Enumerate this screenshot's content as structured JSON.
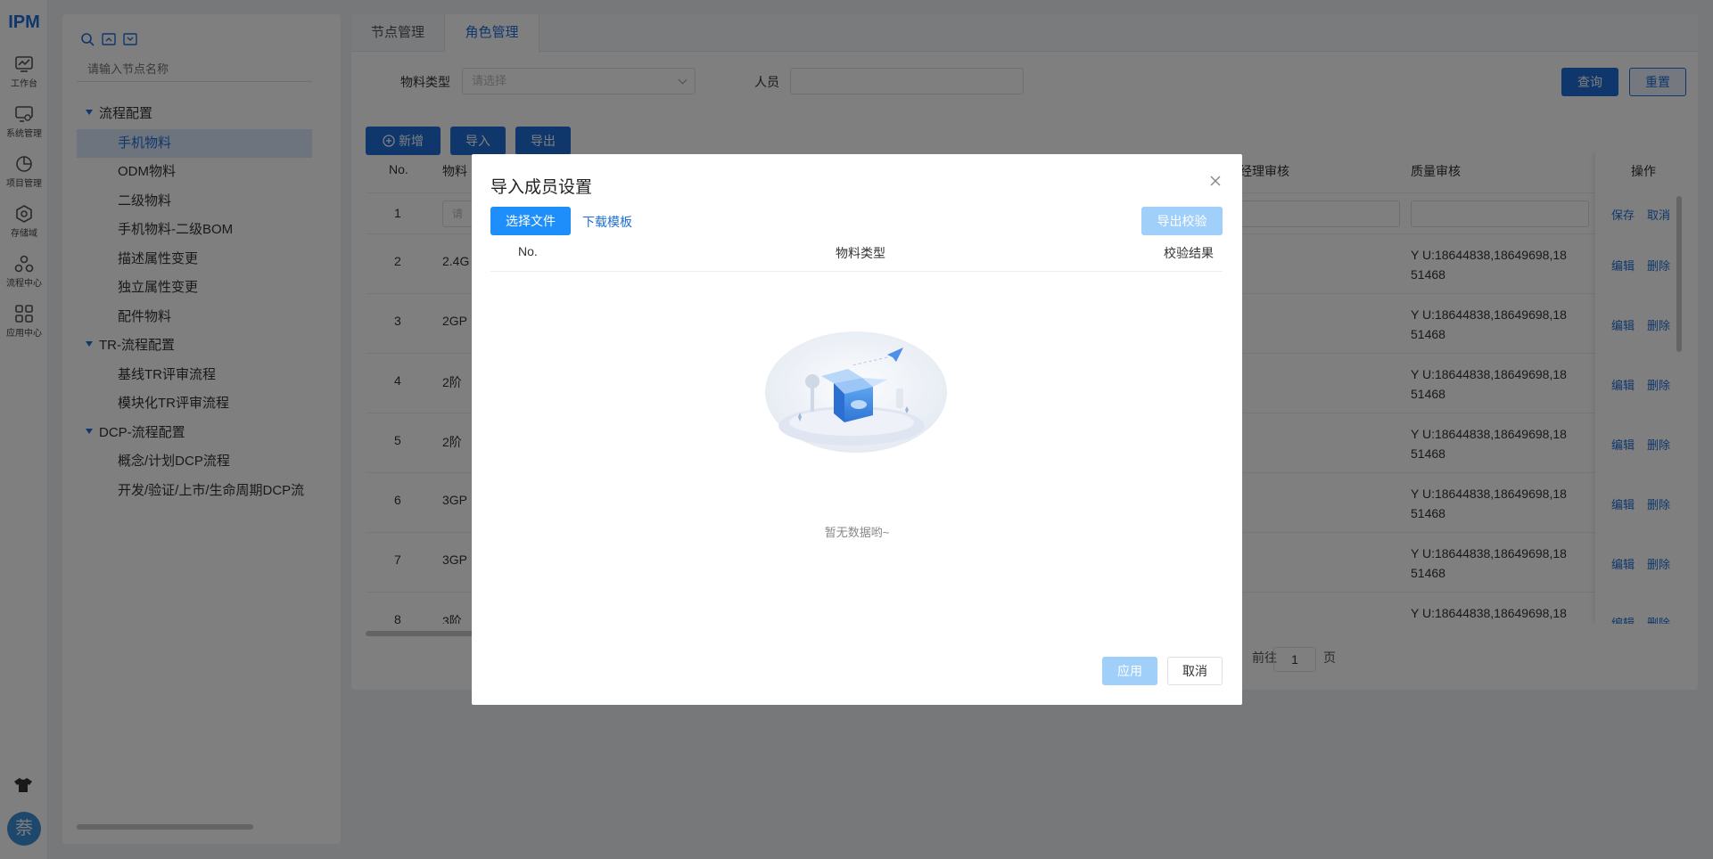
{
  "app": {
    "logo": "IPM",
    "avatar": "萘"
  },
  "rail": [
    {
      "label": "工作台",
      "icon": "chart-board-icon"
    },
    {
      "label": "系统管理",
      "icon": "monitor-settings-icon"
    },
    {
      "label": "项目管理",
      "icon": "pie-chart-icon"
    },
    {
      "label": "存储域",
      "icon": "storage-hexagon-icon"
    },
    {
      "label": "流程中心",
      "icon": "flow-nodes-icon"
    },
    {
      "label": "应用中心",
      "icon": "app-grid-icon"
    }
  ],
  "tree": {
    "search_placeholder": "请输入节点名称",
    "items": [
      {
        "label": "流程配置",
        "type": "group"
      },
      {
        "label": "手机物料",
        "type": "leaf",
        "active": true
      },
      {
        "label": "ODM物料",
        "type": "leaf"
      },
      {
        "label": "二级物料",
        "type": "leaf"
      },
      {
        "label": "手机物料-二级BOM",
        "type": "leaf"
      },
      {
        "label": "描述属性变更",
        "type": "leaf"
      },
      {
        "label": "独立属性变更",
        "type": "leaf"
      },
      {
        "label": "配件物料",
        "type": "leaf"
      },
      {
        "label": "TR-流程配置",
        "type": "group"
      },
      {
        "label": "基线TR评审流程",
        "type": "leaf"
      },
      {
        "label": "模块化TR评审流程",
        "type": "leaf"
      },
      {
        "label": "DCP-流程配置",
        "type": "group"
      },
      {
        "label": "概念/计划DCP流程",
        "type": "leaf"
      },
      {
        "label": "开发/验证/上市/生命周期DCP流",
        "type": "leaf"
      }
    ]
  },
  "main": {
    "tabs": [
      "节点管理",
      "角色管理"
    ],
    "filters": {
      "material_type_label": "物料类型",
      "material_type_placeholder": "请选择",
      "person_label": "人员"
    },
    "buttons": {
      "query": "查询",
      "reset": "重置",
      "add": "新增",
      "import": "导入",
      "export": "导出"
    },
    "columns": {
      "no": "No.",
      "material": "物料",
      "manager_review": "经理审核",
      "quality_review": "质量审核",
      "ops": "操作"
    },
    "rows": [
      {
        "no": "1",
        "material": "",
        "quality_line1": "",
        "quality_line2": "",
        "editing": true
      },
      {
        "no": "2",
        "material": "2.4G",
        "quality_line1": "Y U:18644838,18649698,18",
        "quality_line2": "51468"
      },
      {
        "no": "3",
        "material": "2GP",
        "quality_line1": "Y U:18644838,18649698,18",
        "quality_line2": "51468"
      },
      {
        "no": "4",
        "material": "2阶",
        "quality_line1": "Y U:18644838,18649698,18",
        "quality_line2": "51468"
      },
      {
        "no": "5",
        "material": "2阶",
        "quality_line1": "Y U:18644838,18649698,18",
        "quality_line2": "51468"
      },
      {
        "no": "6",
        "material": "3GP",
        "quality_line1": "Y U:18644838,18649698,18",
        "quality_line2": "51468"
      },
      {
        "no": "7",
        "material": "3GP",
        "quality_line1": "Y U:18644838,18649698,18",
        "quality_line2": "51468"
      },
      {
        "no": "8",
        "material": "3阶",
        "quality_line1": "Y U:18644838,18649698,18",
        "quality_line2": ""
      }
    ],
    "row_actions": {
      "save": "保存",
      "cancel": "取消",
      "edit": "编辑",
      "delete": "删除"
    },
    "row1_input_placeholder": "请",
    "pager": {
      "goto": "前往",
      "page": "1",
      "page_unit": "页"
    }
  },
  "dialog": {
    "title": "导入成员设置",
    "select_file": "选择文件",
    "download_template": "下载模板",
    "export_check": "导出校验",
    "columns": {
      "no": "No.",
      "material_type": "物料类型",
      "result": "校验结果"
    },
    "empty_text": "暂无数据哟~",
    "apply": "应用",
    "cancel": "取消"
  }
}
